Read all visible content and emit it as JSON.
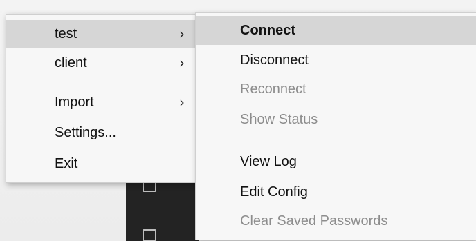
{
  "main_menu": {
    "items": [
      {
        "label": "test",
        "arrow": "›"
      },
      {
        "label": "client",
        "arrow": "›"
      },
      {
        "label": "Import",
        "arrow": "›"
      },
      {
        "label": "Settings..."
      },
      {
        "label": "Exit"
      }
    ]
  },
  "sub_menu": {
    "items": [
      {
        "label": "Connect",
        "state": "hovered"
      },
      {
        "label": "Disconnect",
        "state": "disabled"
      },
      {
        "label": "Reconnect",
        "state": "disabled"
      },
      {
        "label": "Show Status",
        "state": "disabled"
      },
      {
        "label": "View Log",
        "state": "enabled"
      },
      {
        "label": "Edit Config",
        "state": "enabled"
      },
      {
        "label": "Clear Saved Passwords",
        "state": "disabled"
      }
    ]
  },
  "icons": {
    "submenu_arrow": "chevron-right-icon",
    "taskbar_top": "app-icon",
    "taskbar_bottom": "copy-icon"
  }
}
